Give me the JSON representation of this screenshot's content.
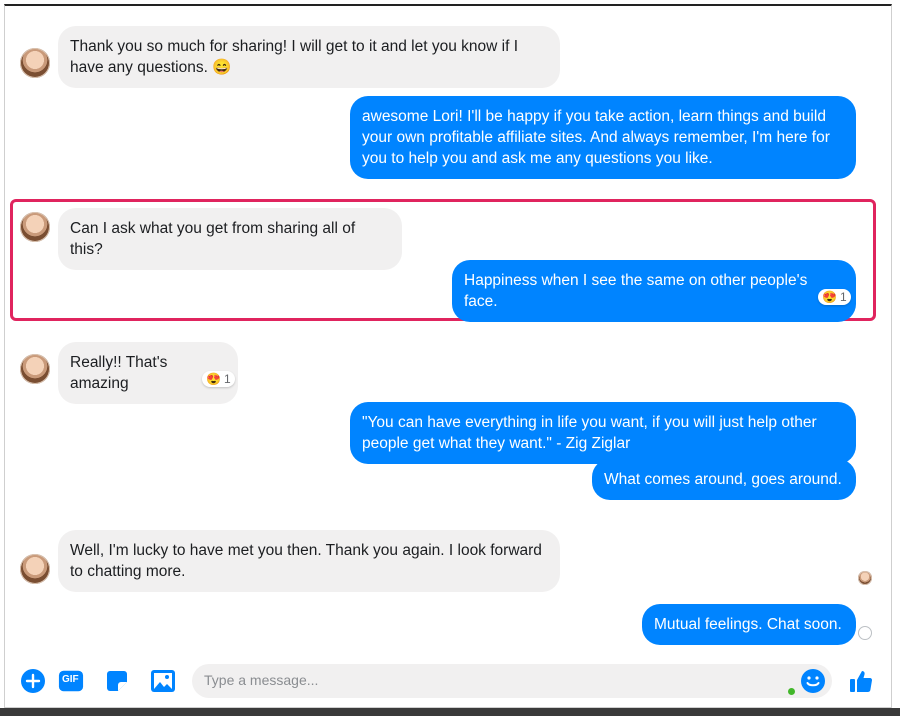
{
  "messages": [
    {
      "side": "in",
      "text": "Thank you so much for sharing!  I will get to it and let you know if I\nhave any questions. 😄"
    },
    {
      "side": "out",
      "text": "awesome Lori! I'll be happy if you take action, learn things and build\nyour own profitable affiliate sites. And always remember, I'm here for\nyou to help you and ask me any questions you like."
    },
    {
      "side": "in",
      "text": "Can I ask what you get from sharing all of this?"
    },
    {
      "side": "out",
      "text": "Happiness when I see the same on other people's face.",
      "reaction": {
        "emoji": "😍",
        "count": "1"
      }
    },
    {
      "side": "in",
      "text": "Really!! That's amazing",
      "reaction": {
        "emoji": "😍",
        "count": "1"
      }
    },
    {
      "side": "out",
      "text": "\"You can have everything in life you want, if you will just help other\npeople get what they want.\" - Zig Ziglar"
    },
    {
      "side": "out",
      "text": "What comes around, goes around."
    },
    {
      "side": "in",
      "text": "Well, I'm lucky to have met you then. Thank you again.  I look forward\nto chatting more."
    },
    {
      "side": "out",
      "text": "Mutual feelings. Chat soon."
    }
  ],
  "composer": {
    "placeholder": "Type a message...",
    "gif_label": "GIF"
  },
  "colors": {
    "accent": "#0084ff",
    "incoming_bg": "#f1f0f0",
    "highlight": "#e0245e"
  }
}
